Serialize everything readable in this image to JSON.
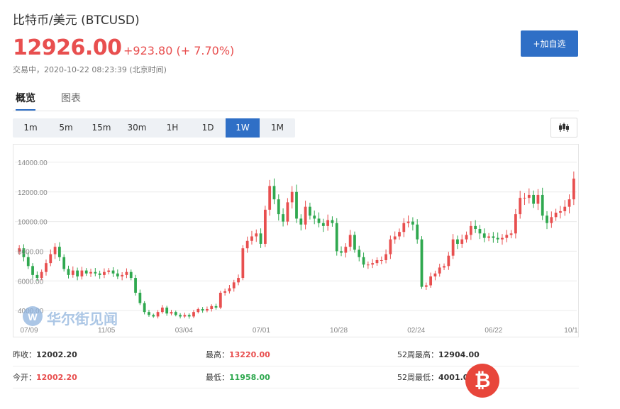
{
  "header": {
    "title": "比特币/美元  (BTCUSD)",
    "price": "12926.00",
    "change": "+923.80 (+ 7.70%)",
    "status": "交易中，2020-10-22 08:23:39 (北京时间)",
    "add_button": "+加自选"
  },
  "tabs": [
    {
      "label": "概览",
      "active": true
    },
    {
      "label": "图表",
      "active": false
    }
  ],
  "toolbar": {
    "periods": [
      "1m",
      "5m",
      "15m",
      "30m",
      "1H",
      "1D",
      "1W",
      "1M"
    ],
    "active": "1W",
    "chart_type_icon": "candlestick-icon"
  },
  "watermark": {
    "text": "华尔街见闻"
  },
  "chart_data": {
    "type": "candlestick",
    "title": "",
    "xlabel": "",
    "ylabel": "",
    "ylim": [
      3000,
      15000
    ],
    "y_ticks": [
      14000,
      12000,
      10000,
      8000,
      6000,
      4000
    ],
    "y_tick_labels": [
      "14000.00",
      "12000.00",
      "10000.00",
      "8000.00",
      "6000.00",
      "4000.00"
    ],
    "x_tick_labels": [
      "07/09",
      "11/05",
      "03/04",
      "07/01",
      "10/28",
      "02/24",
      "06/22",
      "10/1"
    ],
    "up_color": "#e84f4f",
    "down_color": "#2fa84f",
    "series": [
      {
        "values": [
          8200,
          7600,
          7000,
          6400,
          6200,
          6600,
          7200,
          7800,
          8300,
          7600,
          6800,
          6400,
          6700,
          6300,
          6700,
          6500,
          6600,
          6500,
          6400,
          6600,
          6700,
          6500,
          6300,
          6400,
          6600,
          6200,
          5200,
          4500,
          3900,
          3700,
          3600,
          3900,
          4200,
          3800,
          3900,
          3700,
          3600,
          3700,
          3600,
          3900,
          4100,
          4000,
          4100,
          4300,
          4200,
          5200,
          5300,
          5500,
          5900,
          6200,
          8200,
          8700,
          9000,
          9200,
          8500,
          10800,
          12400,
          11500,
          10500,
          10000,
          11300,
          12000,
          10200,
          9800,
          11000,
          10400,
          10200,
          9900,
          9700,
          10100,
          9900,
          8000,
          7900,
          8300,
          9100,
          8100,
          7600,
          7100,
          7100,
          7200,
          7400,
          7400,
          7800,
          8800,
          9000,
          9300,
          9900,
          10000,
          9800,
          8800,
          5600,
          5700,
          6300,
          6500,
          6900,
          7000,
          7700,
          8800,
          8500,
          8800,
          9100,
          9700,
          9500,
          9200,
          8900,
          9000,
          8900,
          8800,
          8900,
          9100,
          9200,
          10500,
          11600,
          11600,
          11800,
          11200,
          11800,
          10400,
          9900,
          10300,
          10600,
          10700,
          11000,
          11500,
          12900
        ]
      }
    ]
  },
  "stats": {
    "prev_close_label": "昨收：",
    "prev_close": "12002.20",
    "high_label": "最高：",
    "high": "13220.00",
    "high52_label": "52周最高：",
    "high52": "12904.00",
    "open_label": "今开：",
    "open": "12002.20",
    "low_label": "最低：",
    "low": "11958.00",
    "low52_label": "52周最低：",
    "low52": "4001.0"
  },
  "colors": {
    "accent": "#2f6fc6",
    "up": "#e84f4f",
    "down": "#2fa84f"
  }
}
